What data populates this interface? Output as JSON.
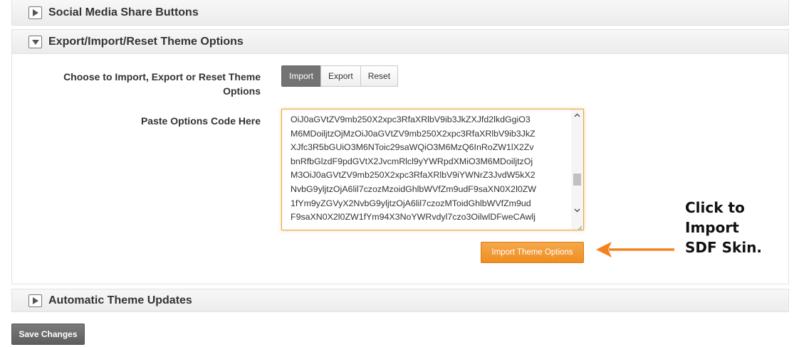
{
  "sections": {
    "social": {
      "title": "Social Media Share Buttons",
      "icon": "triangle-right-icon"
    },
    "export": {
      "title": "Export/Import/Reset Theme Options",
      "icon": "triangle-down-icon"
    },
    "updates": {
      "title": "Automatic Theme Updates",
      "icon": "triangle-right-icon"
    }
  },
  "export_options": {
    "choose_label_line1": "Choose to Import, Export or Reset Theme",
    "choose_label_line2": "Options",
    "segments": [
      "Import",
      "Export",
      "Reset"
    ],
    "active_segment": "Import",
    "paste_label": "Paste Options Code Here",
    "code_lines": [
      "OiJ0aGVtZV9mb250X2xpc3RfaXRlbV9ib3JkZXJfd2lkdGgiO3",
      "M6MDoiljtzOjMzOiJ0aGVtZV9mb250X2xpc3RfaXRlbV9ib3JkZ",
      "XJfc3R5bGUiO3M6NToic29saWQiO3M6MzQ6InRoZW1lX2Zv",
      "bnRfbGlzdF9pdGVtX2JvcmRlcl9yYWRpdXMiO3M6MDoiljtzOj",
      "M3OiJ0aGVtZV9mb250X2xpc3RfaXRlbV9iYWNrZ3JvdW5kX2",
      "NvbG9yljtzOjA6lil7czozMzoidGhlbWVfZm9udF9saXN0X2l0ZW",
      "1fYm9yZGVyX2NvbG9yljtzOjA6lil7czozMToidGhlbWVfZm9ud",
      "F9saXN0X2l0ZW1fYm94X3NoYWRvdyl7czo3OilwlDFweCAwlj"
    ],
    "import_button": "Import Theme Options"
  },
  "annotation": {
    "line1": "Click to",
    "line2": "Import",
    "line3": "SDF Skin.",
    "arrow_color": "#f58220"
  },
  "save_button": "Save Changes",
  "colors": {
    "accent_orange": "#ef8e22",
    "active_segment": "#737373",
    "save_button": "#6a6a6a"
  }
}
